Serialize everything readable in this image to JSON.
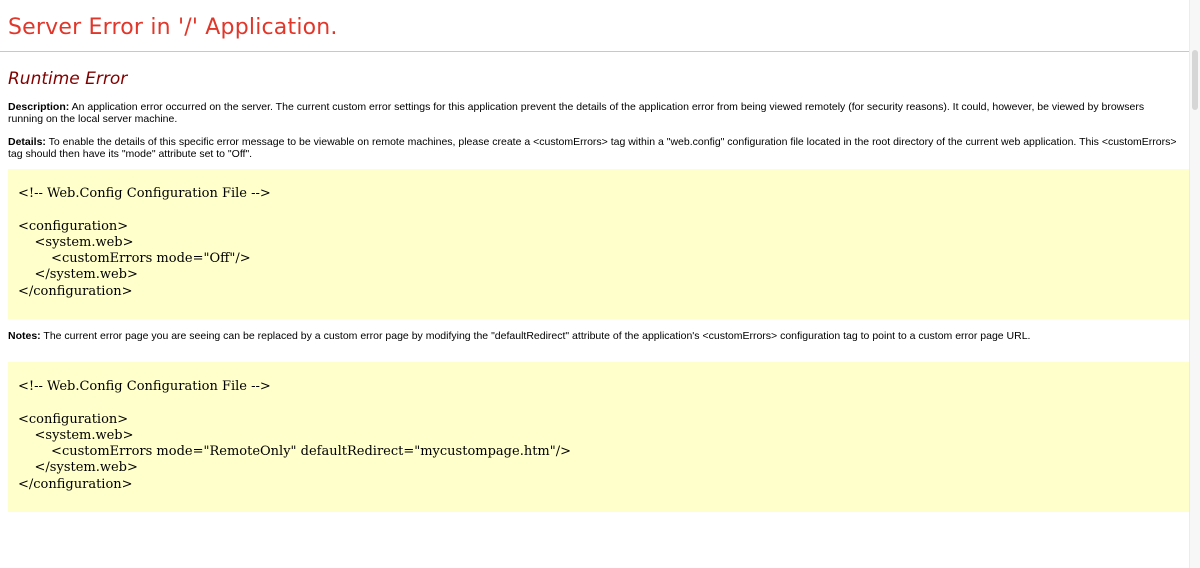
{
  "page": {
    "title": "Server Error in '/' Application.",
    "error_heading": "Runtime Error",
    "description": {
      "label": "Description:",
      "text": " An application error occurred on the server. The current custom error settings for this application prevent the details of the application error from being viewed remotely (for security reasons). It could, however, be viewed by browsers running on the local server machine."
    },
    "details": {
      "label": "Details:",
      "text": " To enable the details of this specific error message to be viewable on remote machines, please create a <customErrors> tag within a \"web.config\" configuration file located in the root directory of the current web application. This <customErrors> tag should then have its \"mode\" attribute set to \"Off\"."
    },
    "code_block_1": {
      "lines": [
        "<!-- Web.Config Configuration File -->",
        "",
        "<configuration>",
        "    <system.web>",
        "        <customErrors mode=\"Off\"/>",
        "    </system.web>",
        "</configuration>"
      ]
    },
    "notes": {
      "label": "Notes:",
      "text": " The current error page you are seeing can be replaced by a custom error page by modifying the \"defaultRedirect\" attribute of the application's <customErrors> configuration tag to point to a custom error page URL."
    },
    "code_block_2": {
      "lines": [
        "<!-- Web.Config Configuration File -->",
        "",
        "<configuration>",
        "    <system.web>",
        "        <customErrors mode=\"RemoteOnly\" defaultRedirect=\"mycustompage.htm\"/>",
        "    </system.web>",
        "</configuration>"
      ]
    }
  },
  "colors": {
    "title": "#e1362a",
    "heading": "#800000",
    "code_background": "#ffffcc",
    "rule": "#c8c8c8"
  }
}
